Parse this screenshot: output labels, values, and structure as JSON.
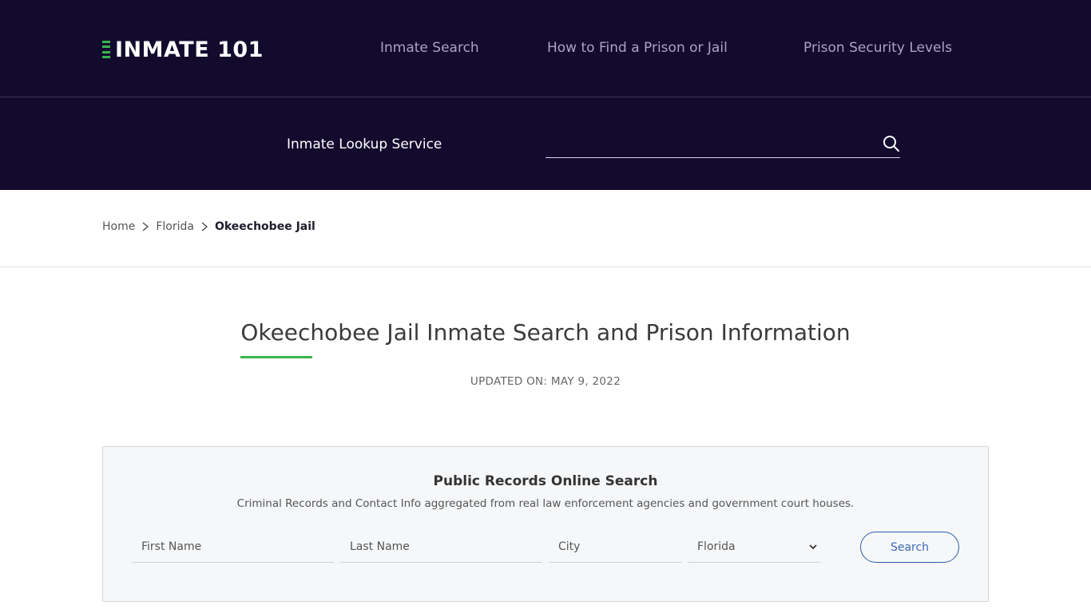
{
  "brand": {
    "logo_text": "INMATE 101",
    "accent_color": "#39b54a",
    "header_bg": "#130b2e"
  },
  "nav": {
    "items": [
      {
        "label": "Inmate Search"
      },
      {
        "label": "How to Find a Prison or Jail"
      },
      {
        "label": "Prison Security Levels"
      }
    ]
  },
  "lookup": {
    "label": "Inmate Lookup Service",
    "input_value": "",
    "placeholder": "",
    "icon": "search-icon"
  },
  "breadcrumb": {
    "items": [
      {
        "label": "Home"
      },
      {
        "label": "Florida"
      },
      {
        "label": "Okeechobee Jail"
      }
    ]
  },
  "page": {
    "title": "Okeechobee Jail Inmate Search and Prison Information",
    "updated": "UPDATED ON: MAY 9, 2022"
  },
  "records_search": {
    "title": "Public Records Online Search",
    "subtitle": "Criminal Records and Contact Info aggregated from real law enforcement agencies and government court houses.",
    "first_name": {
      "placeholder": "First Name",
      "value": ""
    },
    "last_name": {
      "placeholder": "Last Name",
      "value": ""
    },
    "city": {
      "placeholder": "City",
      "value": ""
    },
    "state": {
      "selected": "Florida"
    },
    "button_label": "Search",
    "button_color": "#2a5fa8"
  }
}
